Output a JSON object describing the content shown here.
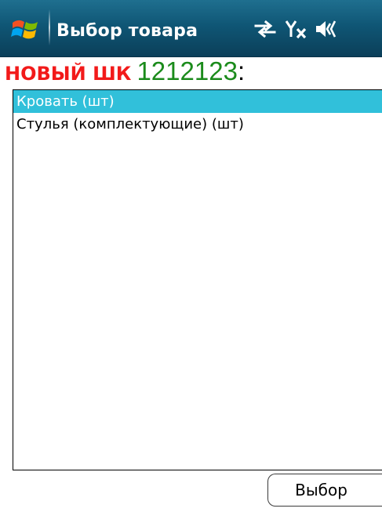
{
  "window": {
    "title": "Выбор товара"
  },
  "status_icons": [
    "start-windows-icon",
    "connectivity-arrows-icon",
    "signal-off-icon",
    "speaker-icon"
  ],
  "heading": {
    "new_label": "НОВЫЙ ШК",
    "barcode": "1212123",
    "suffix": ":"
  },
  "list": {
    "items": [
      {
        "label": "Кровать (шт)",
        "selected": true
      },
      {
        "label": "Стулья (комплектующие) (шт)",
        "selected": false
      }
    ]
  },
  "actions": {
    "select_label": "Выбор"
  },
  "colors": {
    "titlebar": "#0f5675",
    "new_label": "#f21a1a",
    "barcode": "#1b8b1b",
    "selection": "#31c0da"
  }
}
